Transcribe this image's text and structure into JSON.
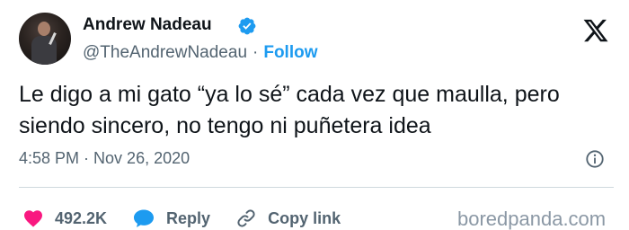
{
  "author": {
    "name": "Andrew Nadeau",
    "handle": "@TheAndrewNadeau",
    "separator": "·",
    "follow_label": "Follow"
  },
  "tweet": {
    "text": "Le digo a mi gato “ya lo sé” cada vez que maulla, pero siendo sincero, no tengo ni puñetera idea",
    "time": "4:58 PM",
    "separator": "·",
    "date": "Nov 26, 2020"
  },
  "actions": {
    "likes": "492.2K",
    "reply_label": "Reply",
    "copy_label": "Copy link"
  },
  "watermark": "boredpanda.com",
  "colors": {
    "accent": "#1d9bf0",
    "like": "#f91880",
    "muted": "#536471",
    "text": "#0f1419"
  },
  "icons": {
    "verified": "verified-badge-icon",
    "brand": "x-logo-icon",
    "info": "info-icon",
    "like": "heart-icon",
    "reply": "speech-bubble-icon",
    "copy": "link-icon"
  }
}
